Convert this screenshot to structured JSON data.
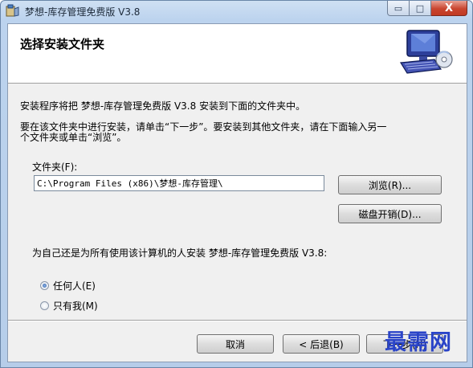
{
  "window": {
    "title": "梦想-库存管理免费版 V3.8",
    "caption_buttons": {
      "minimize": "▭",
      "maximize": "□",
      "close": "X"
    }
  },
  "header": {
    "title": "选择安装文件夹",
    "art_icon": "computer-cd-icon"
  },
  "body": {
    "intro": "安装程序将把 梦想-库存管理免费版 V3.8 安装到下面的文件夹中。",
    "instruction_line1": "要在该文件夹中进行安装，请单击“下一步”。要安装到其他文件夹，请在下面输入另一",
    "instruction_line2": "个文件夹或单击“浏览”。",
    "folder_label": "文件夹(F):",
    "folder_value": "C:\\Program Files (x86)\\梦想-库存管理\\",
    "browse_button": "浏览(R)...",
    "disk_cost_button": "磁盘开销(D)...",
    "install_for_label": "为自己还是为所有使用该计算机的人安装 梦想-库存管理免费版 V3.8:",
    "radio_everyone": "任何人(E)",
    "radio_just_me": "只有我(M)",
    "selected_option": "任何人(E)"
  },
  "footer": {
    "cancel_button": "取消",
    "back_button": "< 后退(B)",
    "next_button": "下一步(N)"
  },
  "watermark": "最需网"
}
